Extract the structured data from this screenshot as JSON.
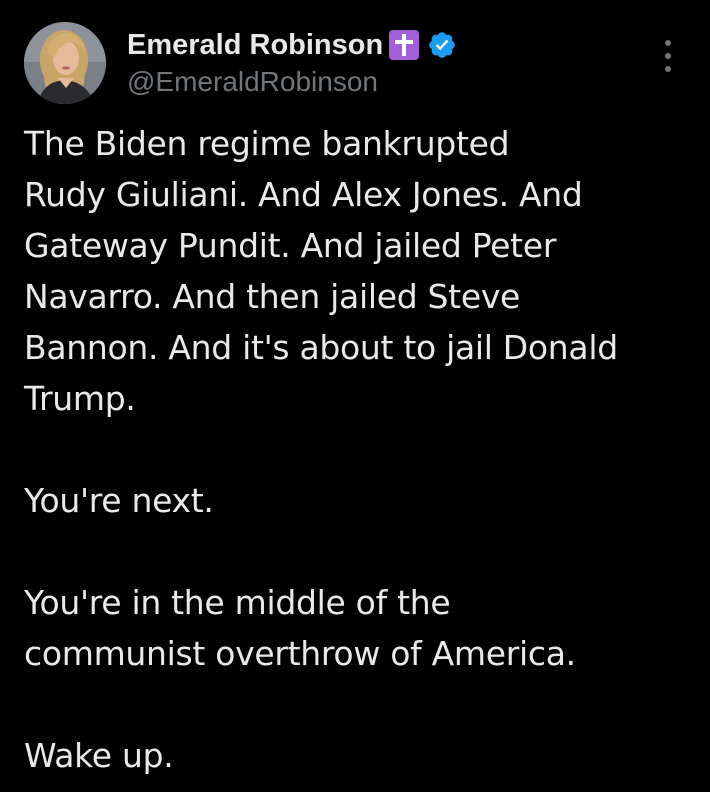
{
  "author": {
    "display_name": "Emerald Robinson",
    "handle": "@EmeraldRobinson",
    "badges": [
      "cross-icon",
      "verified-icon"
    ],
    "avatar": "profile-photo"
  },
  "menu_icon": "more-vertical-icon",
  "tweet": {
    "paragraphs": [
      {
        "lines": [
          "The Biden regime bankrupted",
          "Rudy Giuliani. And Alex Jones. And",
          "Gateway Pundit. And jailed Peter",
          "Navarro. And then jailed Steve",
          "Bannon. And it's about to jail Donald",
          "Trump."
        ]
      },
      {
        "lines": [
          "You're next."
        ]
      },
      {
        "lines": [
          "You're in the middle of the",
          "communist overthrow of America."
        ]
      },
      {
        "lines": [
          "Wake up."
        ]
      }
    ]
  },
  "colors": {
    "background": "#000000",
    "text": "#e7e9ea",
    "secondary": "#71767b",
    "verified": "#1d9bf0",
    "cross_badge": "#a35fd6"
  }
}
